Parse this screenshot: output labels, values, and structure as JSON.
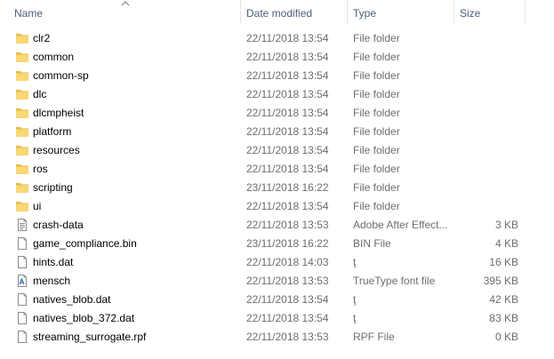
{
  "columns": {
    "name": "Name",
    "date": "Date modified",
    "type": "Type",
    "size": "Size"
  },
  "rows": [
    {
      "name": "clr2",
      "date": "22/11/2018 13:54",
      "type": "File folder",
      "size": "",
      "icon": "folder-icon"
    },
    {
      "name": "common",
      "date": "22/11/2018 13:54",
      "type": "File folder",
      "size": "",
      "icon": "folder-icon"
    },
    {
      "name": "common-sp",
      "date": "22/11/2018 13:54",
      "type": "File folder",
      "size": "",
      "icon": "folder-icon"
    },
    {
      "name": "dlc",
      "date": "22/11/2018 13:54",
      "type": "File folder",
      "size": "",
      "icon": "folder-icon"
    },
    {
      "name": "dlcmpheist",
      "date": "22/11/2018 13:54",
      "type": "File folder",
      "size": "",
      "icon": "folder-icon"
    },
    {
      "name": "platform",
      "date": "22/11/2018 13:54",
      "type": "File folder",
      "size": "",
      "icon": "folder-icon"
    },
    {
      "name": "resources",
      "date": "22/11/2018 13:54",
      "type": "File folder",
      "size": "",
      "icon": "folder-icon"
    },
    {
      "name": "ros",
      "date": "22/11/2018 13:54",
      "type": "File folder",
      "size": "",
      "icon": "folder-icon"
    },
    {
      "name": "scripting",
      "date": "23/11/2018 16:22",
      "type": "File folder",
      "size": "",
      "icon": "folder-icon"
    },
    {
      "name": "ui",
      "date": "22/11/2018 13:54",
      "type": "File folder",
      "size": "",
      "icon": "folder-icon"
    },
    {
      "name": "crash-data",
      "date": "22/11/2018 13:53",
      "type": "Adobe After Effect...",
      "size": "3 KB",
      "icon": "text-document-icon"
    },
    {
      "name": "game_compliance.bin",
      "date": "23/11/2018 16:22",
      "type": "BIN File",
      "size": "4 KB",
      "icon": "blank-file-icon"
    },
    {
      "name": "hints.dat",
      "date": "22/11/2018 14:03",
      "type": "ţ",
      "size": "16 KB",
      "icon": "blank-file-icon"
    },
    {
      "name": "mensch",
      "date": "22/11/2018 13:53",
      "type": "TrueType font file",
      "size": "395 KB",
      "icon": "font-file-icon"
    },
    {
      "name": "natives_blob.dat",
      "date": "22/11/2018 13:54",
      "type": "ţ",
      "size": "42 KB",
      "icon": "blank-file-icon"
    },
    {
      "name": "natives_blob_372.dat",
      "date": "22/11/2018 13:54",
      "type": "ţ",
      "size": "83 KB",
      "icon": "blank-file-icon"
    },
    {
      "name": "streaming_surrogate.rpf",
      "date": "22/11/2018 13:53",
      "type": "RPF File",
      "size": "0 KB",
      "icon": "blank-file-icon"
    }
  ],
  "colors": {
    "header_text": "#4c607a",
    "folder": "#f5cd5c",
    "secondary_text": "#6d6d6d"
  }
}
